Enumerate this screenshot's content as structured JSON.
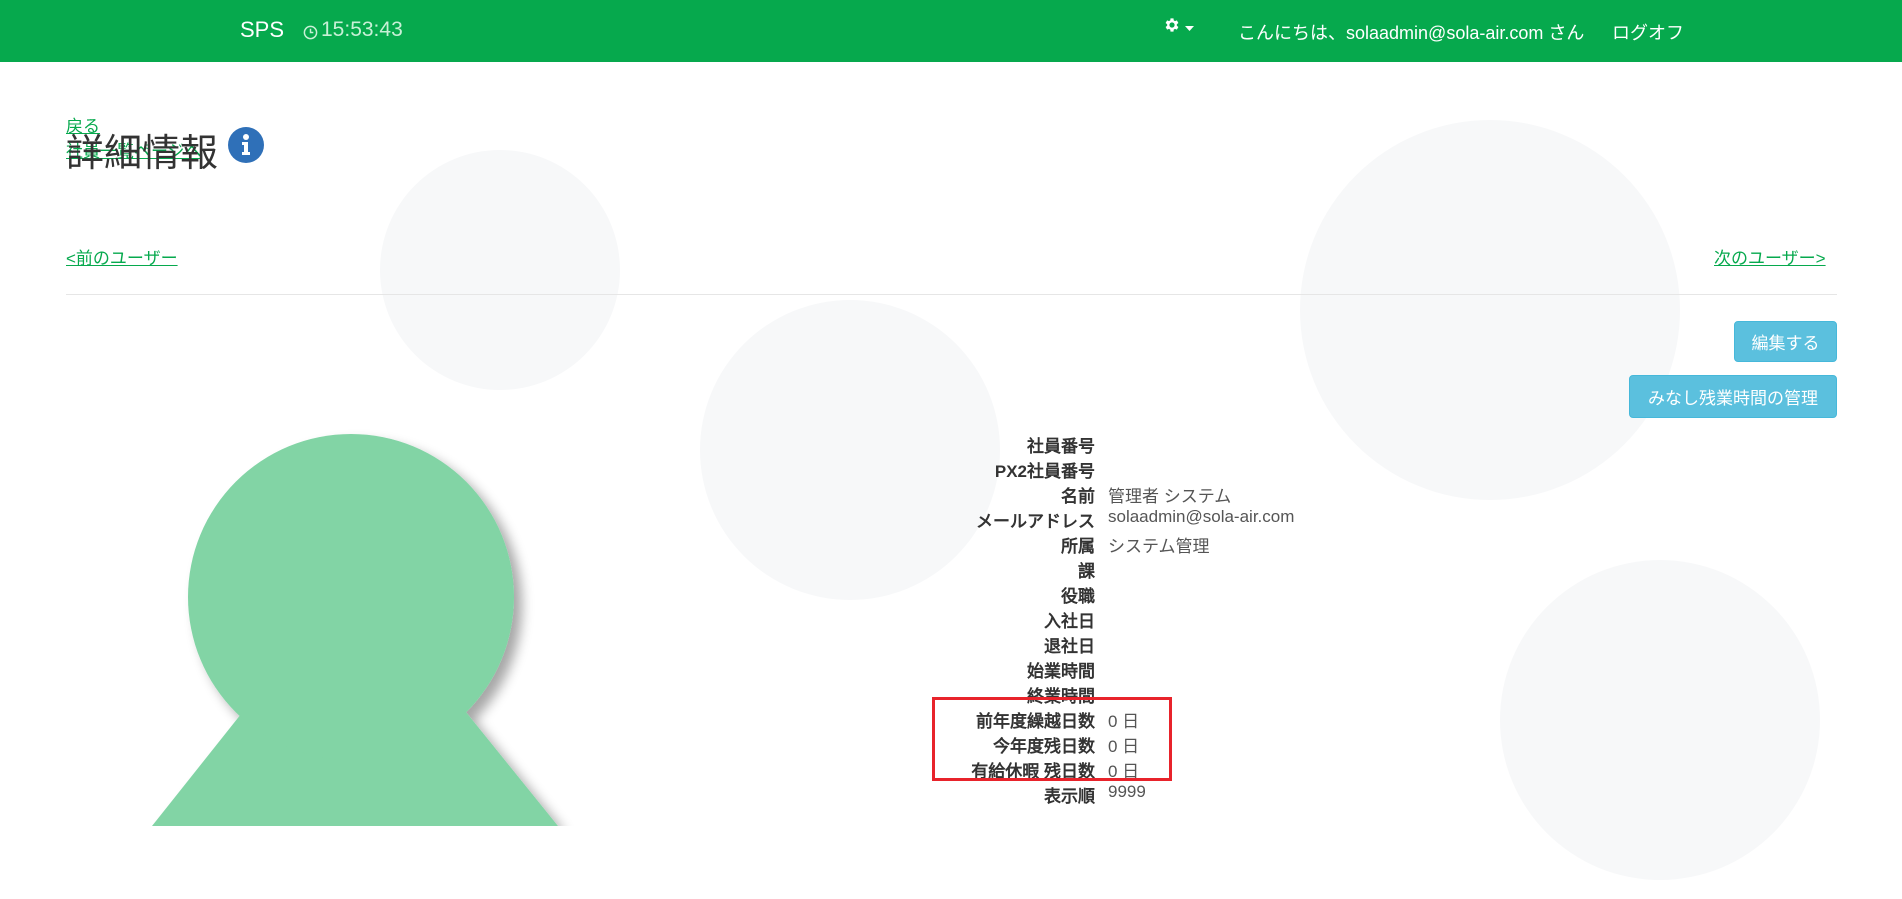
{
  "navbar": {
    "brand": "SPS",
    "clock": "15:53:43",
    "greeting": "こんにちは、solaadmin@sola-air.com さん",
    "logoff": "ログオフ",
    "bg_color": "#06a94d"
  },
  "links": {
    "back": "戻る",
    "employee_list": "社員一覧ページへ",
    "prev_user": "<前のユーザー",
    "next_user": "次のユーザー>"
  },
  "page": {
    "title": "詳細情報"
  },
  "buttons": {
    "edit": "編集する",
    "overtime": "みなし残業時間の管理",
    "color": "#5bc0de"
  },
  "details": [
    {
      "label": "社員番号",
      "value": ""
    },
    {
      "label": "PX2社員番号",
      "value": ""
    },
    {
      "label": "名前",
      "value": "管理者 システム"
    },
    {
      "label": "メールアドレス",
      "value": "solaadmin@sola-air.com"
    },
    {
      "label": "所属",
      "value": "システム管理"
    },
    {
      "label": "課",
      "value": ""
    },
    {
      "label": "役職",
      "value": ""
    },
    {
      "label": "入社日",
      "value": ""
    },
    {
      "label": "退社日",
      "value": ""
    },
    {
      "label": "始業時間",
      "value": ""
    },
    {
      "label": "終業時間",
      "value": ""
    },
    {
      "label": "前年度繰越日数",
      "value": "0 日"
    },
    {
      "label": "今年度残日数",
      "value": "0 日"
    },
    {
      "label": "有給休暇 残日数",
      "value": "0 日"
    },
    {
      "label": "表示順",
      "value": "9999"
    }
  ],
  "icons": {
    "clock": "clock-icon",
    "gear": "gear-icon",
    "caret": "caret-down-icon",
    "info": "info-icon",
    "avatar": "avatar-placeholder"
  },
  "colors": {
    "link": "#06a94d",
    "highlight": "#e8232b",
    "avatar": "#82d4a5"
  }
}
